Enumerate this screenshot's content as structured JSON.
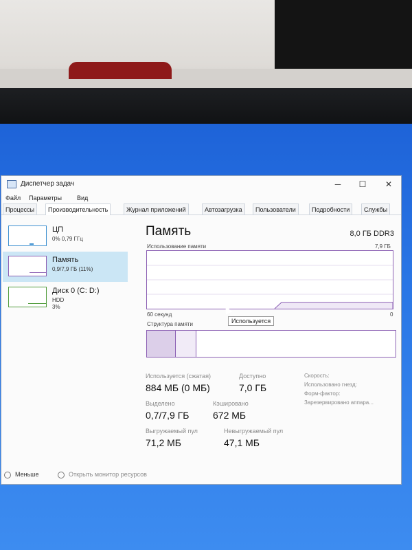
{
  "window": {
    "title": "Диспетчер задач",
    "controls": [
      "─",
      "☐",
      "✕"
    ]
  },
  "menu": [
    "Файл",
    "Параметры",
    "Вид"
  ],
  "tabs": [
    "Процессы",
    "Производительность",
    "Журнал приложений",
    "Автозагрузка",
    "Пользователи",
    "Подробности",
    "Службы"
  ],
  "sidebar": [
    {
      "title": "ЦП",
      "sub1": "0% 0,79 ГГц",
      "sub2": ""
    },
    {
      "title": "Память",
      "sub1": "0,9/7,9 ГБ (11%)",
      "sub2": ""
    },
    {
      "title": "Диск 0 (C: D:)",
      "sub1": "HDD",
      "sub2": "3%"
    }
  ],
  "main": {
    "title": "Память",
    "mem_type": "8,0 ГБ DDR3",
    "usage_label": "Использование памяти",
    "usage_max": "7,9 ГБ",
    "time_label": "60 секунд",
    "time_zero": "0",
    "structure_label": "Структура памяти",
    "tooltip": "Используется",
    "in_use_fraction": 0.11
  },
  "stats": {
    "in_use_label": "Используется (сжатая)",
    "in_use_value": "884 МБ (0 МБ)",
    "available_label": "Доступно",
    "available_value": "7,0 ГБ",
    "committed_label": "Выделено",
    "committed_value": "0,7/7,9 ГБ",
    "cached_label": "Кэшировано",
    "cached_value": "672 МБ",
    "paged_label": "Выгружаемый пул",
    "paged_value": "71,2 МБ",
    "nonpaged_label": "Невыгружаемый пул",
    "nonpaged_value": "47,1 МБ",
    "speed_label": "Скорость:",
    "slots_label": "Использовано гнезд:",
    "form_label": "Форм-фактор:",
    "reserved_label": "Зарезервировано аппара..."
  },
  "footer": {
    "less": "Меньше",
    "monitor": "Открыть монитор ресурсов"
  },
  "colors": {
    "memory_accent": "#8b5fb3",
    "selection": "#cbe6f5",
    "cpu_accent": "#3c8fd0",
    "disk_accent": "#4f9b3a"
  }
}
